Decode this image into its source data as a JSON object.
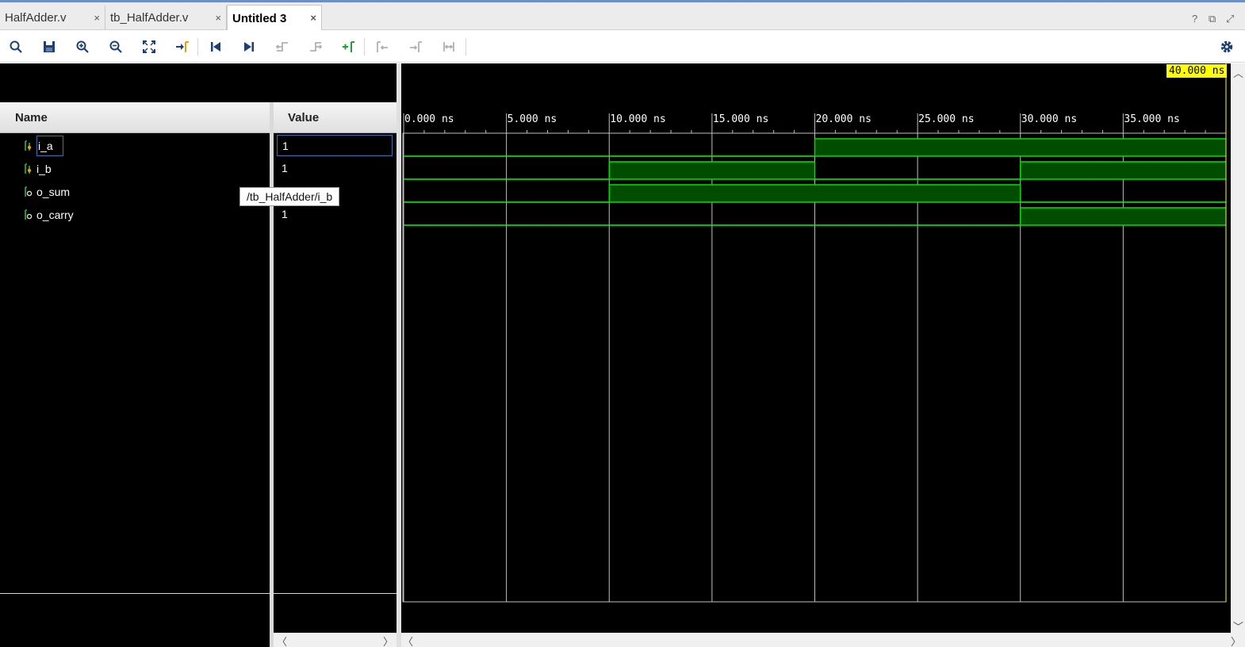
{
  "tabs": [
    {
      "label": "HalfAdder.v",
      "close": "×",
      "active": false
    },
    {
      "label": "tb_HalfAdder.v",
      "close": "×",
      "active": false
    },
    {
      "label": "Untitled 3",
      "close": "×",
      "active": true
    }
  ],
  "window_controls": {
    "help": "?",
    "restore": "⧉",
    "maximize": "⤢"
  },
  "toolbar": {
    "icons": [
      "search-icon",
      "save-icon",
      "zoom-in-icon",
      "zoom-out-icon",
      "zoom-fit-icon",
      "go-to-cursor-icon",
      "go-to-time-zero-icon",
      "go-to-last-time-icon",
      "previous-transition-icon",
      "next-transition-icon",
      "add-marker-icon",
      "previous-marker-icon",
      "next-marker-icon",
      "swap-cursors-icon",
      "settings-gear-icon"
    ]
  },
  "columns": {
    "name": "Name",
    "value": "Value"
  },
  "signals": [
    {
      "name": "i_a",
      "value": "1",
      "kind": "input"
    },
    {
      "name": "i_b",
      "value": "1",
      "kind": "input"
    },
    {
      "name": "o_sum",
      "value": "",
      "kind": "output"
    },
    {
      "name": "o_carry",
      "value": "1",
      "kind": "output"
    }
  ],
  "tooltip": "/tb_HalfAdder/i_b",
  "cursor_time_label": "40.000 ns",
  "chart_data": {
    "type": "line",
    "chart_kind": "digital-waveform",
    "time_unit": "ns",
    "xlim": [
      0,
      40
    ],
    "tick_labels": [
      "0.000 ns",
      "5.000 ns",
      "10.000 ns",
      "15.000 ns",
      "20.000 ns",
      "25.000 ns",
      "30.000 ns",
      "35.000 ns"
    ],
    "ticks": [
      0,
      5,
      10,
      15,
      20,
      25,
      30,
      35
    ],
    "cursor": 40,
    "series": [
      {
        "name": "i_a",
        "segments": [
          [
            0,
            20,
            0
          ],
          [
            20,
            40,
            1
          ]
        ]
      },
      {
        "name": "i_b",
        "segments": [
          [
            0,
            10,
            0
          ],
          [
            10,
            20,
            1
          ],
          [
            20,
            30,
            0
          ],
          [
            30,
            40,
            1
          ]
        ]
      },
      {
        "name": "o_sum",
        "segments": [
          [
            0,
            10,
            0
          ],
          [
            10,
            30,
            1
          ],
          [
            30,
            40,
            0
          ]
        ]
      },
      {
        "name": "o_carry",
        "segments": [
          [
            0,
            30,
            0
          ],
          [
            30,
            40,
            1
          ]
        ]
      }
    ],
    "colors": {
      "low": "#00ff00",
      "high_fill": "#004d00",
      "high_line": "#00e000",
      "grid": "#bfbfbf",
      "cursor_label_bg": "#ffff00"
    }
  }
}
